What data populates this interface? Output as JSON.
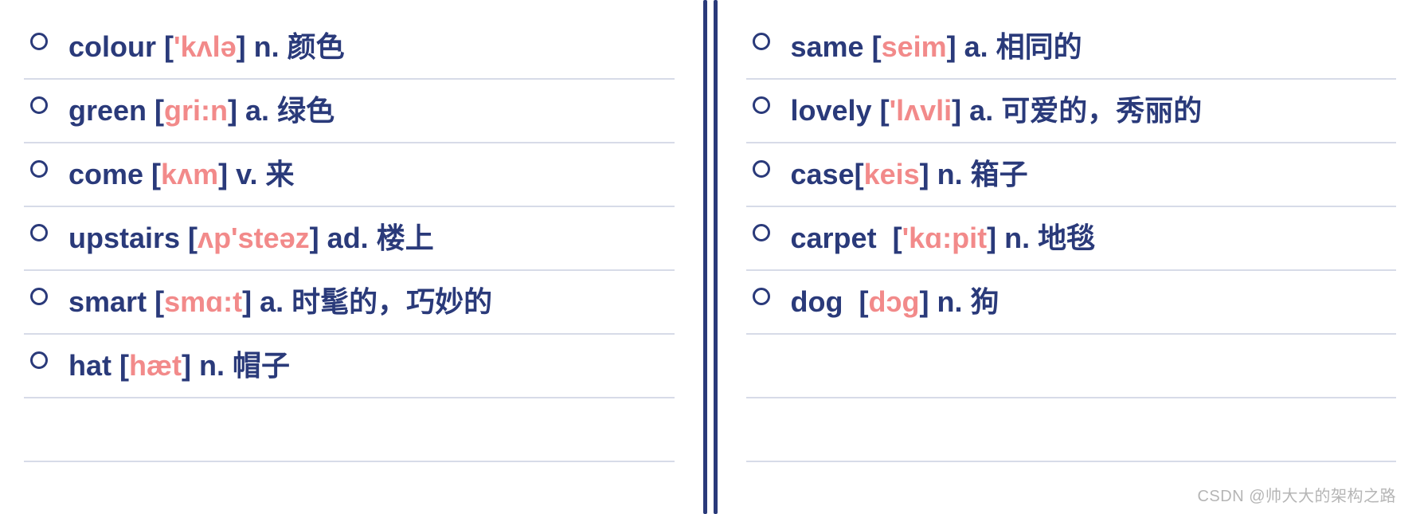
{
  "colors": {
    "text": "#2a3a7a",
    "ipa": "#f28a8a",
    "rule": "#d7dbe8"
  },
  "watermark": "CSDN @帅大大的架构之路",
  "left": [
    {
      "word": "colour",
      "open": " [",
      "ipa": "'kʌlə",
      "close": "] ",
      "pos": "n.",
      "def": " 颜色"
    },
    {
      "word": "green",
      "open": " [",
      "ipa": "gri:n",
      "close": "] ",
      "pos": "a.",
      "def": " 绿色"
    },
    {
      "word": "come",
      "open": " [",
      "ipa": "kʌm",
      "close": "] ",
      "pos": "v.",
      "def": " 来"
    },
    {
      "word": "upstairs",
      "open": " [",
      "ipa": "ʌp'steəz",
      "close": "] ",
      "pos": "ad.",
      "def": " 楼上"
    },
    {
      "word": "smart",
      "open": " [",
      "ipa": "smɑ:t",
      "close": "] ",
      "pos": "a.",
      "def": " 时髦的，巧妙的"
    },
    {
      "word": "hat",
      "open": " [",
      "ipa": "hæt",
      "close": "] ",
      "pos": "n.",
      "def": " 帽子"
    }
  ],
  "right": [
    {
      "word": "same",
      "open": " [",
      "ipa": "seim",
      "close": "] ",
      "pos": "a.",
      "def": " 相同的"
    },
    {
      "word": "lovely",
      "open": " [",
      "ipa": "'lʌvli",
      "close": "] ",
      "pos": "a.",
      "def": " 可爱的，秀丽的"
    },
    {
      "word": "case",
      "open": "[",
      "ipa": "keis",
      "close": "] ",
      "pos": "n.",
      "def": " 箱子"
    },
    {
      "word": "carpet",
      "open": "  [",
      "ipa": "'kɑ:pit",
      "close": "] ",
      "pos": "n.",
      "def": " 地毯"
    },
    {
      "word": "dog",
      "open": "  [",
      "ipa": "dɔg",
      "close": "] ",
      "pos": "n.",
      "def": " 狗"
    }
  ]
}
